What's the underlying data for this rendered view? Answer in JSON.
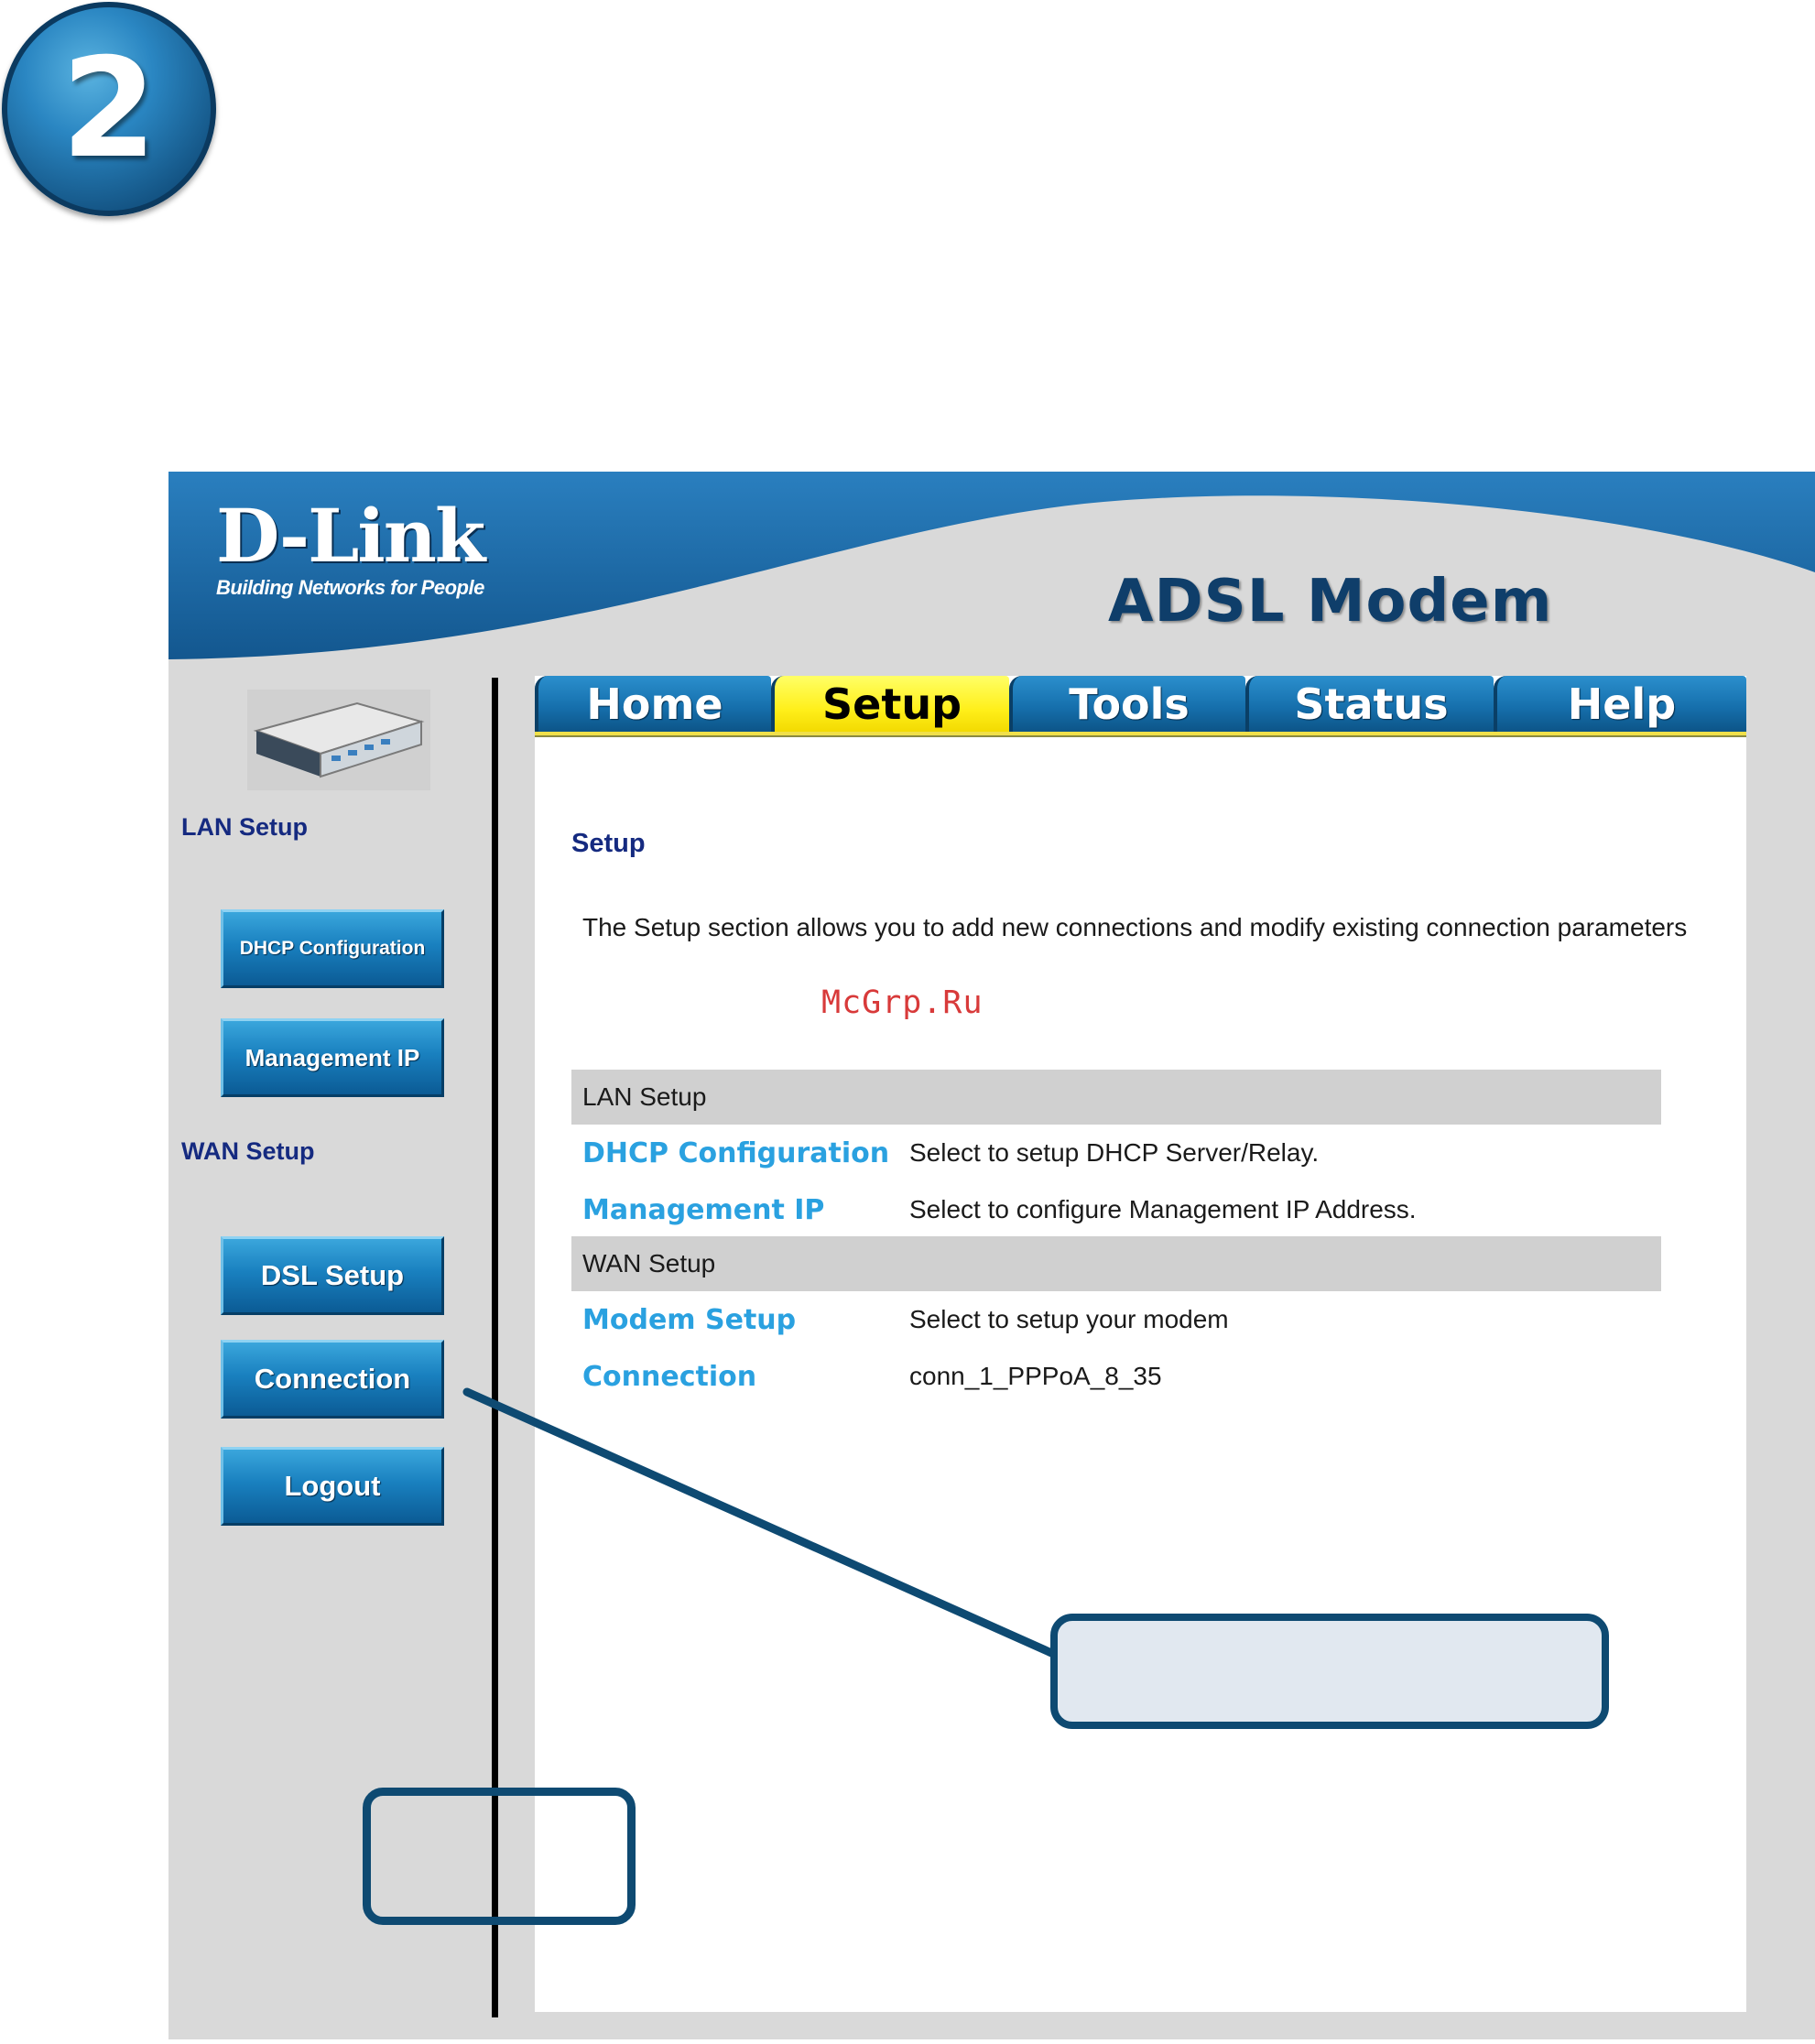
{
  "step_number": "2",
  "brand": {
    "name": "D-Link",
    "tagline": "Building Networks for People",
    "product": "ADSL Modem"
  },
  "tabs": [
    {
      "label": "Home",
      "active": false
    },
    {
      "label": "Setup",
      "active": true
    },
    {
      "label": "Tools",
      "active": false
    },
    {
      "label": "Status",
      "active": false
    },
    {
      "label": "Help",
      "active": false
    }
  ],
  "sidebar": {
    "lan_heading": "LAN Setup",
    "wan_heading": "WAN Setup",
    "buttons": {
      "dhcp": "DHCP Configuration",
      "management_ip": "Management IP",
      "dsl_setup": "DSL Setup",
      "connection": "Connection",
      "logout": "Logout"
    }
  },
  "content": {
    "title": "Setup",
    "intro": "The Setup section allows you to add new connections and modify existing connection parameters",
    "watermark": "McGrp.Ru",
    "lan_section": "LAN Setup",
    "wan_section": "WAN Setup",
    "rows": {
      "dhcp": {
        "link": "DHCP Configuration",
        "desc": "Select to setup DHCP Server/Relay."
      },
      "management_ip": {
        "link": "Management IP",
        "desc": "Select to configure Management IP Address."
      },
      "modem_setup": {
        "link": "Modem Setup",
        "desc": "Select to setup your modem"
      },
      "connection": {
        "link": "Connection",
        "desc": "conn_1_PPPoA_8_35"
      }
    }
  },
  "colors": {
    "brand_blue": "#1670ad",
    "active_tab": "#ffef1a",
    "link": "#2aa1e0",
    "heading": "#152a80",
    "callout_border": "#0e4a72",
    "callout_fill": "#e1e8f0"
  }
}
